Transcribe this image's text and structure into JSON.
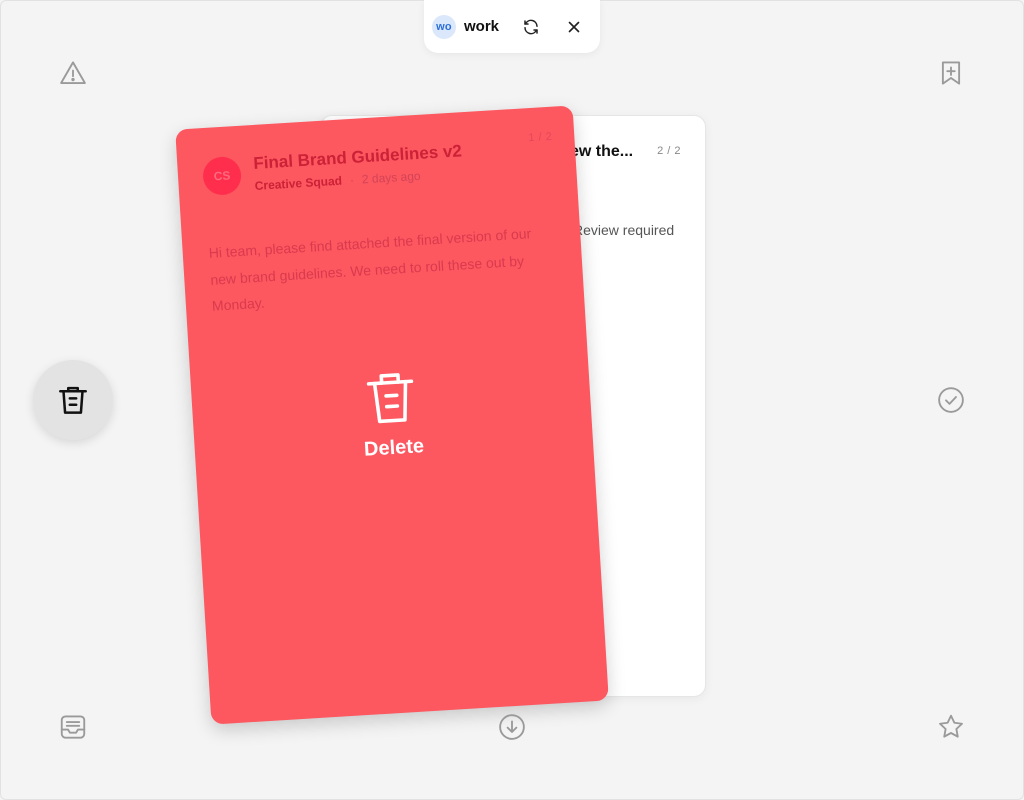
{
  "workspace": {
    "initials": "wo",
    "name": "work"
  },
  "front_card": {
    "avatar_initials": "CS",
    "title": "Final Brand Guidelines v2",
    "sender": "Creative Squad",
    "separator": "·",
    "time": "2 days ago",
    "counter": "1 / 2",
    "body": "Hi team, please find attached the final version of our new brand guidelines. We need to roll these out by Monday."
  },
  "swipe_overlay": {
    "label": "Delete",
    "icon": "trash-icon"
  },
  "back_card": {
    "title_fragment": "ew the...",
    "counter": "2 / 2",
    "body_fragment": "Review required"
  },
  "actions": {
    "top_left": "alert-triangle-icon",
    "left_middle": "trash-icon",
    "bottom_left": "inbox-tray-icon",
    "top_right": "bookmark-plus-icon",
    "right_middle": "check-circle-icon",
    "bottom_right": "star-icon",
    "bottom_center": "download-circle-icon"
  },
  "colors": {
    "background": "#f4f4f4",
    "delete_red": "#fd5760",
    "avatar_red": "#ff2e4d",
    "workspace_blue": "#2d6fd8"
  }
}
